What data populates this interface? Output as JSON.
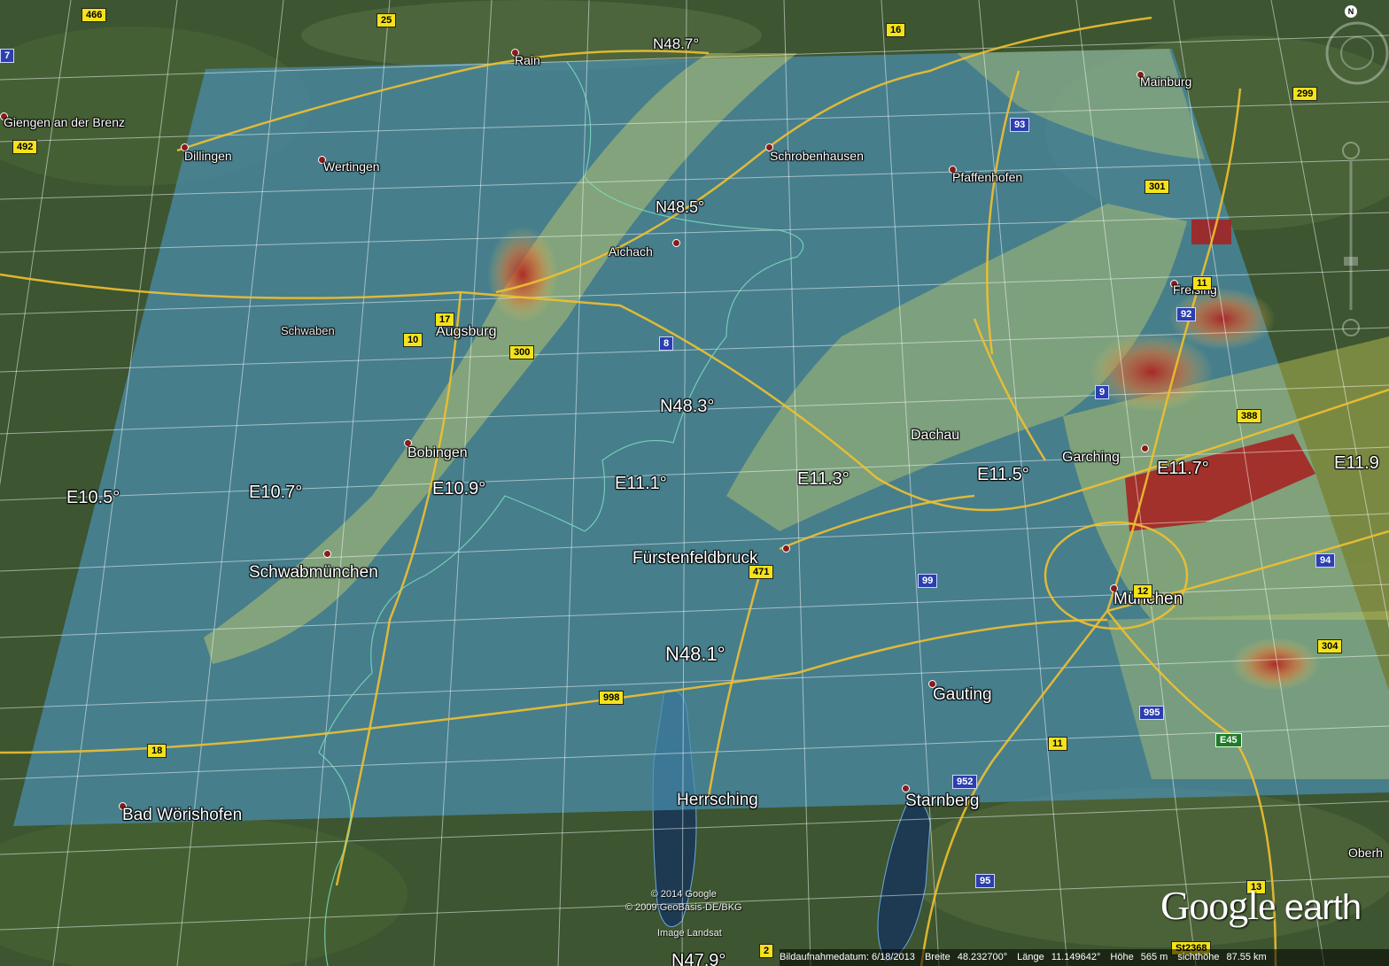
{
  "places": [
    {
      "id": "rain",
      "label": "Rain"
    },
    {
      "id": "giengen",
      "label": "Giengen an der Brenz"
    },
    {
      "id": "mainburg",
      "label": "Mainburg"
    },
    {
      "id": "dillingen",
      "label": "Dillingen"
    },
    {
      "id": "wertingen",
      "label": "Wertingen"
    },
    {
      "id": "schrobenhausen",
      "label": "Schrobenhausen"
    },
    {
      "id": "pfaffenhofen",
      "label": "Pfaffenhofen"
    },
    {
      "id": "aichach",
      "label": "Aichach"
    },
    {
      "id": "freising",
      "label": "Freising"
    },
    {
      "id": "schwaben",
      "label": "Schwaben"
    },
    {
      "id": "augsburg",
      "label": "Augsburg"
    },
    {
      "id": "dachau",
      "label": "Dachau"
    },
    {
      "id": "garching",
      "label": "Garching"
    },
    {
      "id": "bobingen",
      "label": "Bobingen"
    },
    {
      "id": "fuerstenfeldbruck",
      "label": "Fürstenfeldbruck"
    },
    {
      "id": "schwabmuenchen",
      "label": "Schwabmünchen"
    },
    {
      "id": "muenchen",
      "label": "München"
    },
    {
      "id": "gauting",
      "label": "Gauting"
    },
    {
      "id": "herrsching",
      "label": "Herrsching"
    },
    {
      "id": "starnberg",
      "label": "Starnberg"
    },
    {
      "id": "bad_woerishofen",
      "label": "Bad Wörishofen"
    },
    {
      "id": "oberh",
      "label": "Oberh"
    }
  ],
  "grid_labels": [
    {
      "id": "n487",
      "label": "N48.7°"
    },
    {
      "id": "n485",
      "label": "N48.5°"
    },
    {
      "id": "n483",
      "label": "N48.3°"
    },
    {
      "id": "n481",
      "label": "N48.1°"
    },
    {
      "id": "n479",
      "label": "N47.9°"
    },
    {
      "id": "e105",
      "label": "E10.5°"
    },
    {
      "id": "e107",
      "label": "E10.7°"
    },
    {
      "id": "e109",
      "label": "E10.9°"
    },
    {
      "id": "e111",
      "label": "E11.1°"
    },
    {
      "id": "e113",
      "label": "E11.3°"
    },
    {
      "id": "e115",
      "label": "E11.5°"
    },
    {
      "id": "e117",
      "label": "E11.7°"
    },
    {
      "id": "e119",
      "label": "E11.9"
    }
  ],
  "road_shields": [
    {
      "id": "r466",
      "label": "466",
      "color": "yellow"
    },
    {
      "id": "r25",
      "label": "25",
      "color": "yellow"
    },
    {
      "id": "r16",
      "label": "16",
      "color": "yellow"
    },
    {
      "id": "r7",
      "label": "7",
      "color": "blue"
    },
    {
      "id": "r492",
      "label": "492",
      "color": "yellow"
    },
    {
      "id": "r93",
      "label": "93",
      "color": "blue"
    },
    {
      "id": "r299",
      "label": "299",
      "color": "yellow"
    },
    {
      "id": "r301",
      "label": "301",
      "color": "yellow"
    },
    {
      "id": "r17",
      "label": "17",
      "color": "yellow"
    },
    {
      "id": "r10",
      "label": "10",
      "color": "yellow"
    },
    {
      "id": "r300",
      "label": "300",
      "color": "yellow"
    },
    {
      "id": "r8",
      "label": "8",
      "color": "blue"
    },
    {
      "id": "r11b",
      "label": "11",
      "color": "yellow"
    },
    {
      "id": "r92",
      "label": "92",
      "color": "blue"
    },
    {
      "id": "r9",
      "label": "9",
      "color": "blue"
    },
    {
      "id": "r388",
      "label": "388",
      "color": "yellow"
    },
    {
      "id": "r471",
      "label": "471",
      "color": "yellow"
    },
    {
      "id": "r99",
      "label": "99",
      "color": "blue"
    },
    {
      "id": "r94",
      "label": "94",
      "color": "blue"
    },
    {
      "id": "r12",
      "label": "12",
      "color": "yellow"
    },
    {
      "id": "r304",
      "label": "304",
      "color": "yellow"
    },
    {
      "id": "r998",
      "label": "998",
      "color": "yellow"
    },
    {
      "id": "r995",
      "label": "995",
      "color": "blue"
    },
    {
      "id": "r18",
      "label": "18",
      "color": "yellow"
    },
    {
      "id": "r11",
      "label": "11",
      "color": "yellow"
    },
    {
      "id": "re45",
      "label": "E45",
      "color": "green"
    },
    {
      "id": "r952",
      "label": "952",
      "color": "blue"
    },
    {
      "id": "r95",
      "label": "95",
      "color": "blue"
    },
    {
      "id": "r13",
      "label": "13",
      "color": "yellow"
    },
    {
      "id": "r2",
      "label": "2",
      "color": "yellow"
    },
    {
      "id": "rst2368",
      "label": "St2368",
      "color": "yellow"
    }
  ],
  "copyright": {
    "line1": "© 2014 Google",
    "line2": "© 2009 GeoBasis-DE/BKG"
  },
  "image_credit": "Image Landsat",
  "logo": {
    "word1": "Google",
    "word2": "earth"
  },
  "status_bar": {
    "date_label": "Bildaufnahmedatum: 6/18/2013",
    "lat_label": "Breite",
    "lat_value": "48.232700°",
    "lon_label": "Länge",
    "lon_value": "11.149642°",
    "elev_label": "Höhe",
    "elev_value": "565 m",
    "eye_label": "sichthöhe",
    "eye_value": "87.55 km"
  },
  "compass": {
    "north": "N"
  },
  "colors": {
    "overlay_low": "#4a8fb0",
    "overlay_mid": "#d8d860",
    "overlay_high": "#b01f1f",
    "road": "#f0c030",
    "land": "#3f5530"
  }
}
